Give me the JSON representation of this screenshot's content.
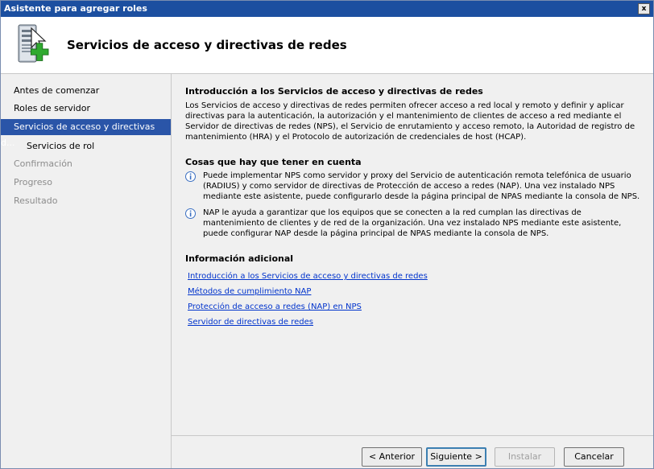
{
  "window": {
    "title": "Asistente para agregar roles",
    "close_label": "x"
  },
  "header": {
    "title": "Servicios de acceso y directivas de redes"
  },
  "sidebar": {
    "items": [
      {
        "label": "Antes de comenzar",
        "state": "normal"
      },
      {
        "label": "Roles de servidor",
        "state": "normal"
      },
      {
        "label": "Servicios de acceso y directivas d...",
        "state": "selected"
      },
      {
        "label": "Servicios de rol",
        "state": "normal"
      },
      {
        "label": "Confirmación",
        "state": "disabled"
      },
      {
        "label": "Progreso",
        "state": "disabled"
      },
      {
        "label": "Resultado",
        "state": "disabled"
      }
    ]
  },
  "content": {
    "intro_title": "Introducción a los Servicios de acceso y directivas de redes",
    "intro_text": "Los Servicios de acceso y directivas de redes permiten ofrecer acceso a red local y remoto y definir y aplicar directivas para la autenticación, la autorización y el mantenimiento de clientes de acceso a red mediante el Servidor de directivas de redes (NPS), el Servicio de enrutamiento y acceso remoto, la Autoridad de registro de mantenimiento (HRA) y el Protocolo de autorización de credenciales de host (HCAP).",
    "notes_title": "Cosas que hay que tener en cuenta",
    "notes": [
      "Puede implementar NPS como servidor y proxy del Servicio de autenticación remota telefónica de usuario (RADIUS) y como servidor de directivas de Protección de acceso a redes (NAP). Una vez instalado NPS mediante este asistente, puede configurarlo desde la página principal de NPAS mediante la consola de NPS.",
      "NAP le ayuda a garantizar que los equipos que se conecten a la red cumplan las directivas de mantenimiento de clientes y de red de la organización. Una vez instalado NPS mediante este asistente, puede configurar NAP desde la página principal de NPAS mediante la consola de NPS."
    ],
    "info_title": "Información adicional",
    "links": [
      "Introducción a los Servicios de acceso y directivas de redes",
      "Métodos de cumplimiento NAP",
      "Protección de acceso a redes (NAP) en NPS",
      "Servidor de directivas de redes"
    ]
  },
  "footer": {
    "back_label": "< Anterior",
    "next_label": "Siguiente >",
    "install_label": "Instalar",
    "cancel_label": "Cancelar"
  },
  "colors": {
    "titlebar": "#1c4fa0",
    "selected_item": "#2a55a8",
    "link": "#0033cc",
    "panel": "#f0f0f0"
  },
  "icons": {
    "header": "server-add-role-icon",
    "note": "info-icon",
    "close": "close-icon"
  }
}
